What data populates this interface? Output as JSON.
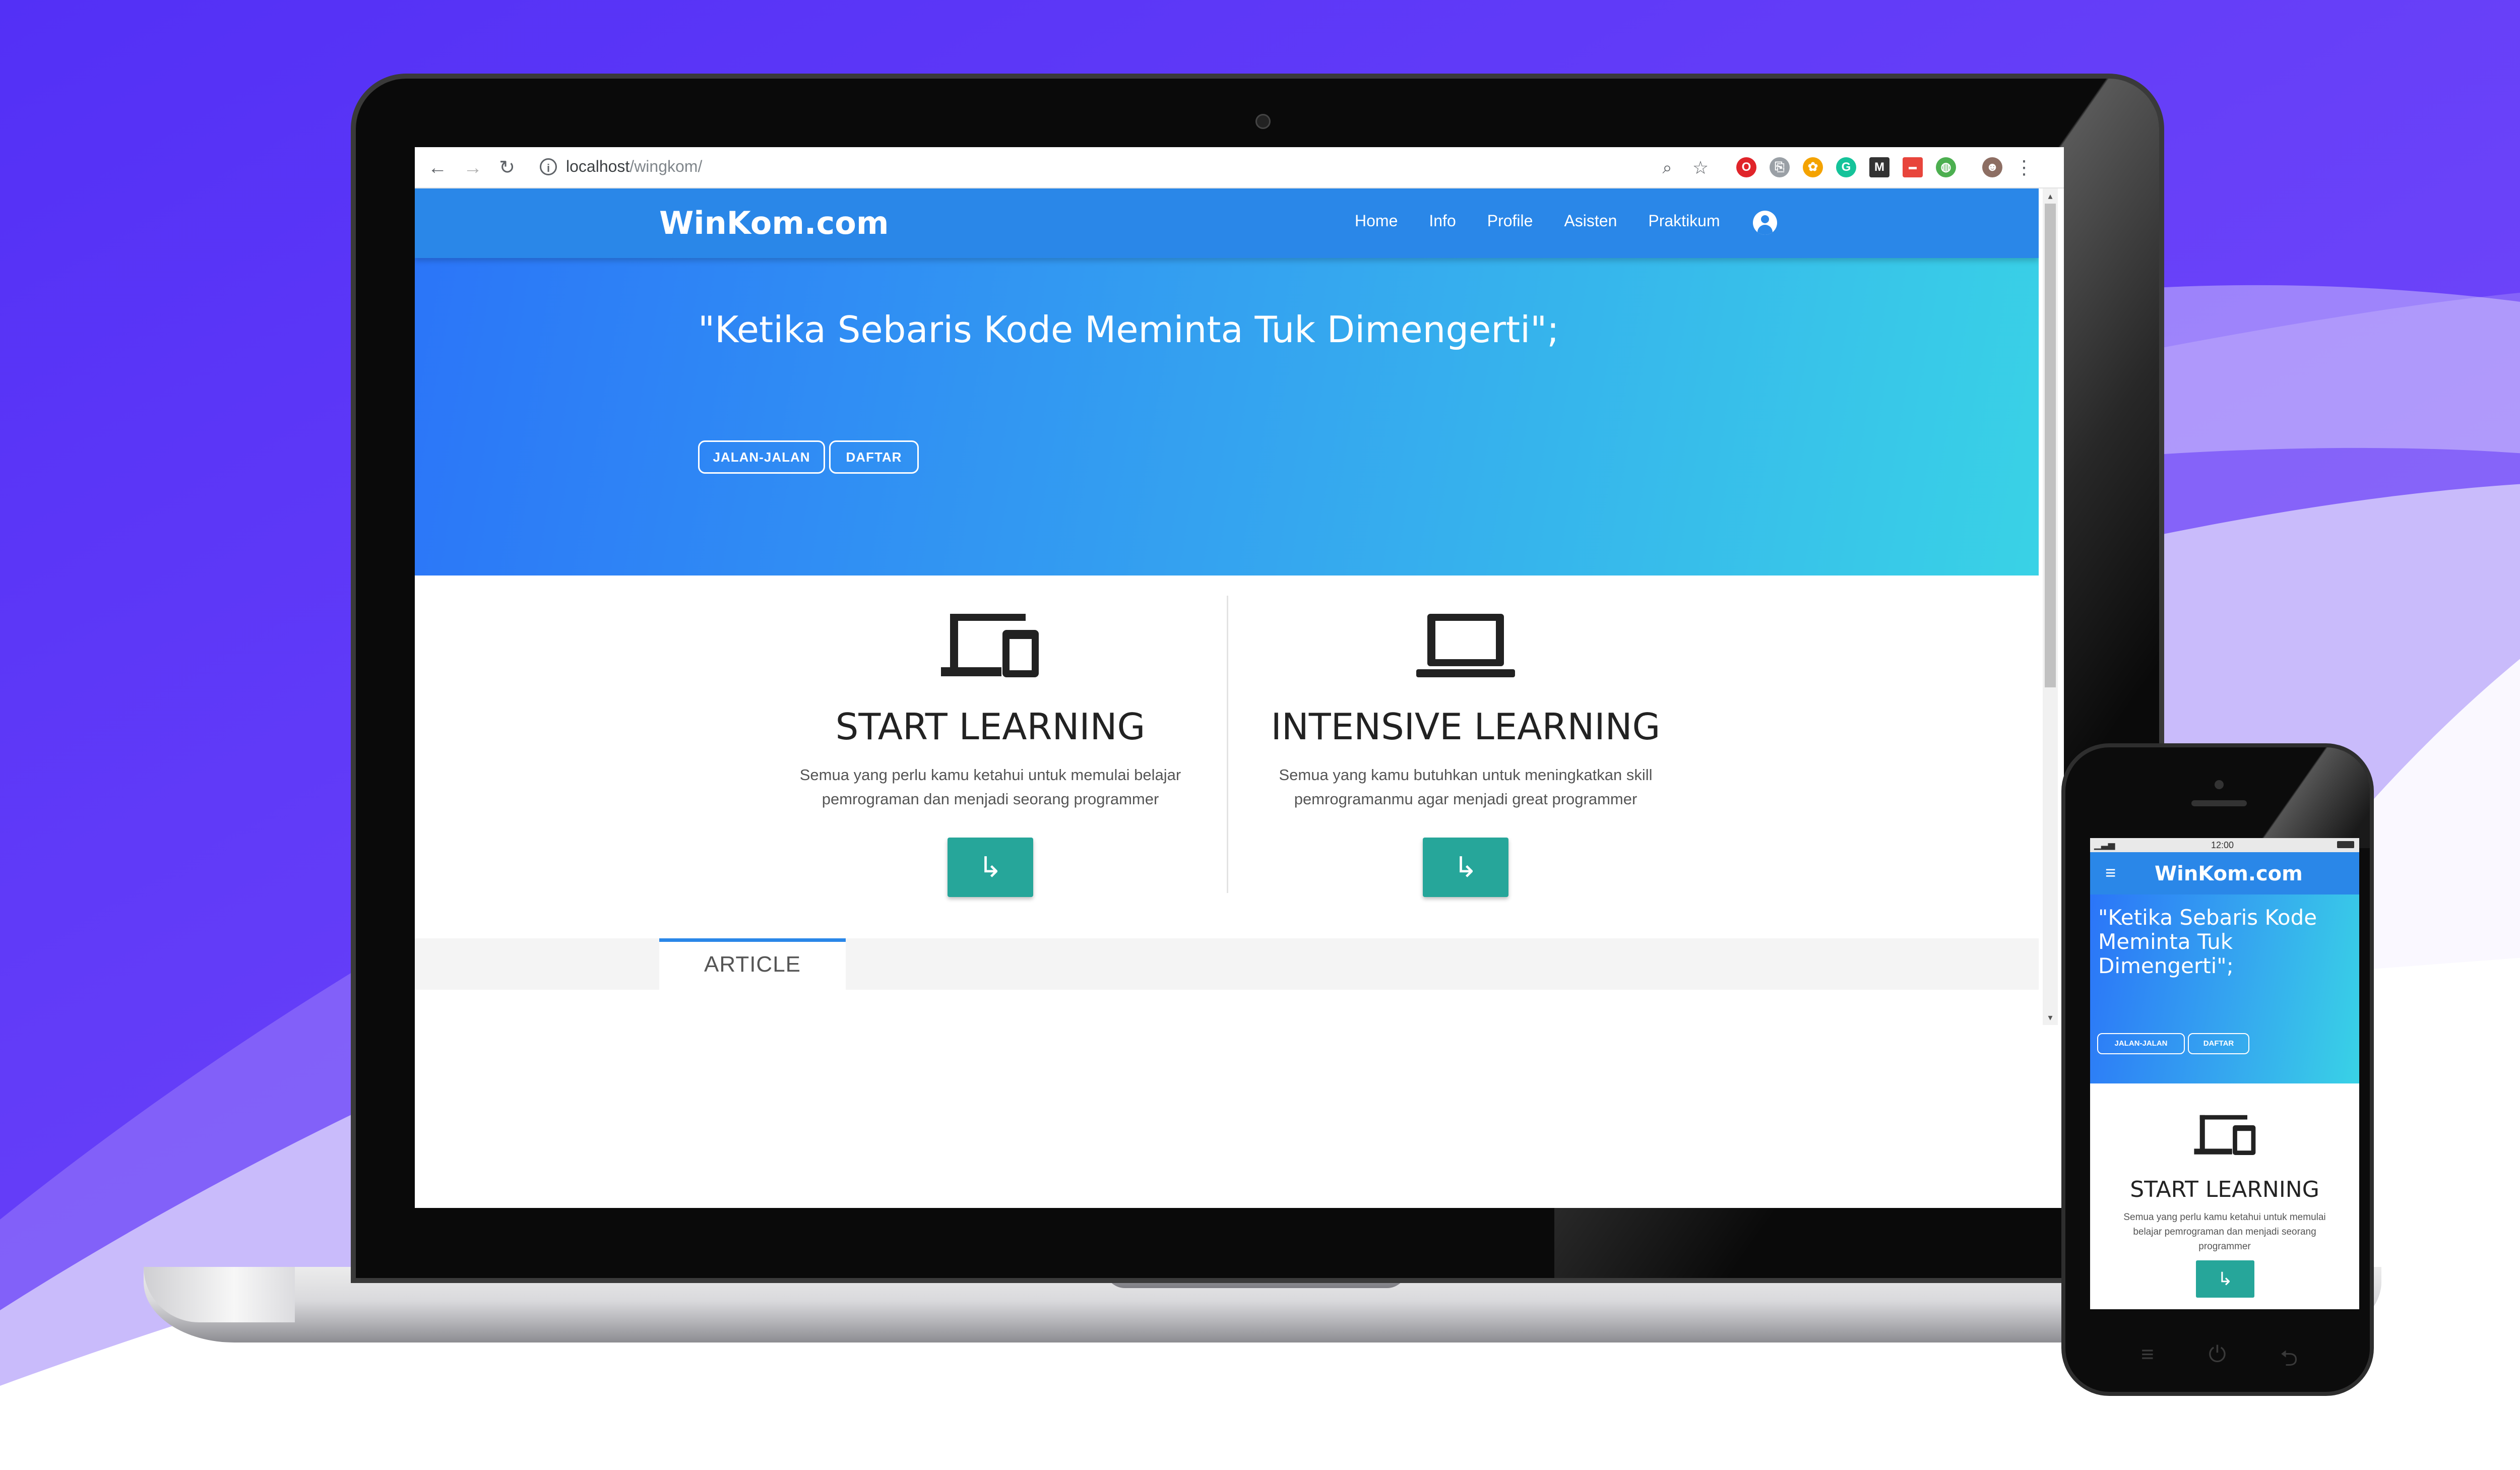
{
  "browser": {
    "url_host": "localhost",
    "url_path": "/wingkom/"
  },
  "site": {
    "brand": "WinKom.com",
    "nav_links": [
      "Home",
      "Info",
      "Profile",
      "Asisten",
      "Praktikum"
    ],
    "hero_quote": "\"Ketika Sebaris Kode Meminta Tuk Dimengerti\";",
    "hero_buttons": [
      "JALAN-JALAN",
      "DAFTAR"
    ],
    "features": [
      {
        "icon": "devices-icon",
        "title": "START LEARNING",
        "description": "Semua yang perlu kamu ketahui untuk memulai belajar pemrograman dan menjadi seorang programmer",
        "button_glyph": "↳"
      },
      {
        "icon": "laptop-icon",
        "title": "INTENSIVE LEARNING",
        "description": "Semua yang kamu butuhkan untuk meningkatkan skill pemrogramanmu agar menjadi great programmer",
        "button_glyph": "↳"
      }
    ],
    "tab_label": "ARTICLE"
  },
  "phone": {
    "status_time": "12:00",
    "hamburger_glyph": "≡",
    "back_glyph": "⮌",
    "power_glyph": "⏻"
  },
  "colors": {
    "background": "#5b37f7",
    "navbar": "#2a87e8",
    "hero_start": "#2b75f8",
    "hero_end": "#39d2e6",
    "accent_button": "#26a69a"
  }
}
